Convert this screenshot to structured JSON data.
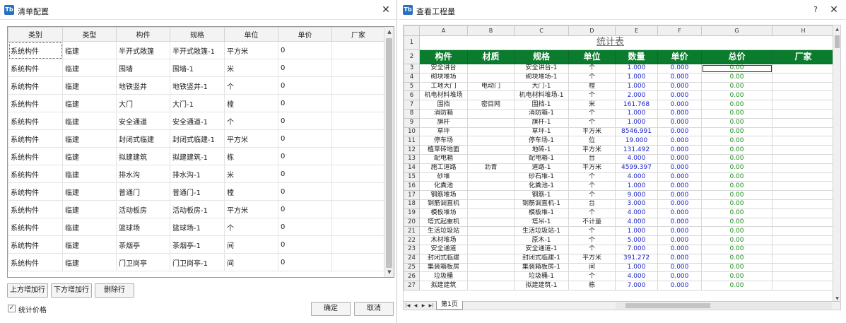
{
  "left": {
    "title": "清单配置",
    "columns": [
      "类别",
      "类型",
      "构件",
      "规格",
      "单位",
      "单价",
      "厂家"
    ],
    "rows": [
      [
        "系统构件",
        "临建",
        "半开式敞篷",
        "半开式敞篷-1",
        "平方米",
        "0",
        ""
      ],
      [
        "系统构件",
        "临建",
        "围墙",
        "围墙-1",
        "米",
        "0",
        ""
      ],
      [
        "系统构件",
        "临建",
        "地铁竖井",
        "地铁竖井-1",
        "个",
        "0",
        ""
      ],
      [
        "系统构件",
        "临建",
        "大门",
        "大门-1",
        "樘",
        "0",
        ""
      ],
      [
        "系统构件",
        "临建",
        "安全通道",
        "安全通道-1",
        "个",
        "0",
        ""
      ],
      [
        "系统构件",
        "临建",
        "封闭式临建",
        "封闭式临建-1",
        "平方米",
        "0",
        ""
      ],
      [
        "系统构件",
        "临建",
        "拟建建筑",
        "拟建建筑-1",
        "栋",
        "0",
        ""
      ],
      [
        "系统构件",
        "临建",
        "排水沟",
        "排水沟-1",
        "米",
        "0",
        ""
      ],
      [
        "系统构件",
        "临建",
        "普通门",
        "普通门-1",
        "樘",
        "0",
        ""
      ],
      [
        "系统构件",
        "临建",
        "活动板房",
        "活动板房-1",
        "平方米",
        "0",
        ""
      ],
      [
        "系统构件",
        "临建",
        "篮球场",
        "篮球场-1",
        "个",
        "0",
        ""
      ],
      [
        "系统构件",
        "临建",
        "茶烟亭",
        "茶烟亭-1",
        "间",
        "0",
        ""
      ],
      [
        "系统构件",
        "临建",
        "门卫岗亭",
        "门卫岗亭-1",
        "间",
        "0",
        ""
      ]
    ],
    "buttons": {
      "insert_above": "上方增加行",
      "insert_below": "下方增加行",
      "delete_row": "删除行",
      "ok": "确定",
      "cancel": "取消"
    },
    "checkbox_label": "统计价格",
    "checkbox_checked": true
  },
  "right": {
    "title": "查看工程量",
    "col_letters": [
      "A",
      "B",
      "C",
      "D",
      "E",
      "F",
      "G",
      "H"
    ],
    "sheet_title": "统计表",
    "headers": [
      "构件",
      "材质",
      "规格",
      "单位",
      "数量",
      "单价",
      "总价",
      "厂家"
    ],
    "rows": [
      [
        "3",
        "安全讲台",
        "",
        "安全讲台-1",
        "个",
        "1.000",
        "0.000",
        "0.00",
        ""
      ],
      [
        "4",
        "砌块堆场",
        "",
        "砌块堆场-1",
        "个",
        "1.000",
        "0.000",
        "0.00",
        ""
      ],
      [
        "5",
        "工地大门",
        "电动门",
        "大门-1",
        "樘",
        "1.000",
        "0.000",
        "0.00",
        ""
      ],
      [
        "6",
        "机电材料堆场",
        "",
        "机电材料堆场-1",
        "个",
        "2.000",
        "0.000",
        "0.00",
        ""
      ],
      [
        "7",
        "围挡",
        "密目网",
        "围挡-1",
        "米",
        "161.768",
        "0.000",
        "0.00",
        ""
      ],
      [
        "8",
        "消防箱",
        "",
        "消防箱-1",
        "个",
        "1.000",
        "0.000",
        "0.00",
        ""
      ],
      [
        "9",
        "旗杆",
        "",
        "旗杆-1",
        "个",
        "1.000",
        "0.000",
        "0.00",
        ""
      ],
      [
        "10",
        "草坪",
        "",
        "草坪-1",
        "平方米",
        "8546.991",
        "0.000",
        "0.00",
        ""
      ],
      [
        "11",
        "停车场",
        "",
        "停车场-1",
        "位",
        "19.000",
        "0.000",
        "0.00",
        ""
      ],
      [
        "12",
        "植草砖地面",
        "",
        "地砖-1",
        "平方米",
        "131.492",
        "0.000",
        "0.00",
        ""
      ],
      [
        "13",
        "配电箱",
        "",
        "配电箱-1",
        "台",
        "4.000",
        "0.000",
        "0.00",
        ""
      ],
      [
        "14",
        "施工道路",
        "沥青",
        "道路-1",
        "平方米",
        "4599.397",
        "0.000",
        "0.00",
        ""
      ],
      [
        "15",
        "砂堆",
        "",
        "砂石堆-1",
        "个",
        "4.000",
        "0.000",
        "0.00",
        ""
      ],
      [
        "16",
        "化粪池",
        "",
        "化粪池-1",
        "个",
        "1.000",
        "0.000",
        "0.00",
        ""
      ],
      [
        "17",
        "钢筋堆场",
        "",
        "钢筋-1",
        "个",
        "9.000",
        "0.000",
        "0.00",
        ""
      ],
      [
        "18",
        "钢筋调直机",
        "",
        "钢筋调直机-1",
        "台",
        "3.000",
        "0.000",
        "0.00",
        ""
      ],
      [
        "19",
        "模板堆场",
        "",
        "模板堆-1",
        "个",
        "4.000",
        "0.000",
        "0.00",
        ""
      ],
      [
        "20",
        "塔式起重机",
        "",
        "塔吊-1",
        "不计量",
        "4.000",
        "0.000",
        "0.00",
        ""
      ],
      [
        "21",
        "生活垃圾站",
        "",
        "生活垃圾站-1",
        "个",
        "1.000",
        "0.000",
        "0.00",
        ""
      ],
      [
        "22",
        "木材堆场",
        "",
        "原木-1",
        "个",
        "5.000",
        "0.000",
        "0.00",
        ""
      ],
      [
        "23",
        "安全通道",
        "",
        "安全通道-1",
        "个",
        "7.000",
        "0.000",
        "0.00",
        ""
      ],
      [
        "24",
        "封闭式临建",
        "",
        "封闭式临建-1",
        "平方米",
        "391.272",
        "0.000",
        "0.00",
        ""
      ],
      [
        "25",
        "集装箱板房",
        "",
        "集装箱板房-1",
        "间",
        "1.000",
        "0.000",
        "0.00",
        ""
      ],
      [
        "26",
        "垃圾桶",
        "",
        "垃圾桶-1",
        "个",
        "4.000",
        "0.000",
        "0.00",
        ""
      ],
      [
        "27",
        "拟建建筑",
        "",
        "拟建建筑-1",
        "栋",
        "7.000",
        "0.000",
        "0.00",
        ""
      ]
    ],
    "sheet_tab": "第1页",
    "help_label": "?",
    "close_label": "✕"
  },
  "colors": {
    "header_green": "#0b7c2d",
    "number_blue": "#1a24c9",
    "value_green": "#1a8a1a"
  }
}
